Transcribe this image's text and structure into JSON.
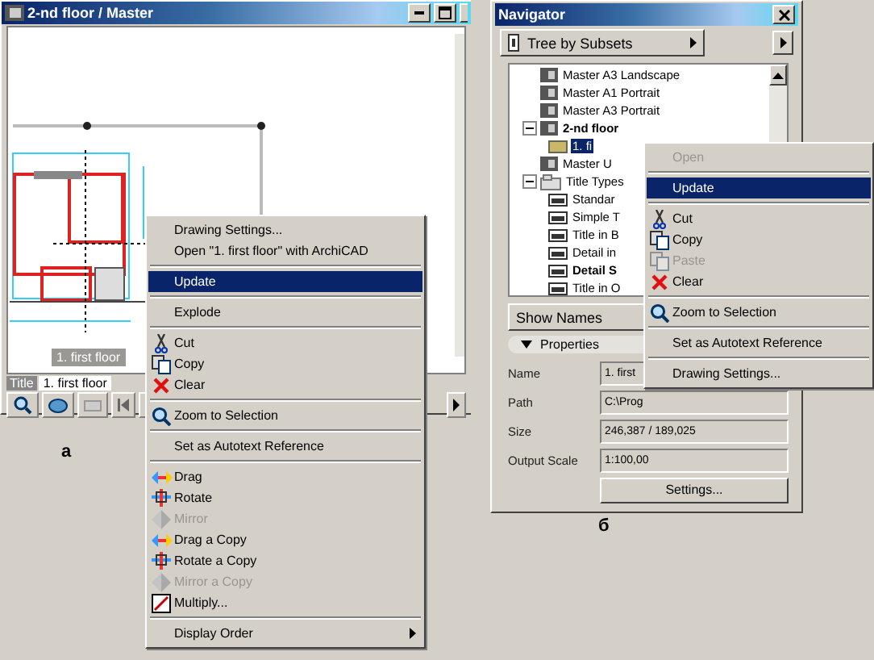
{
  "left_window": {
    "title": "2-nd floor / Master",
    "drawing_label": "1. first floor",
    "title_tab": "Title",
    "title_field": "1. first floor"
  },
  "left_menu": [
    {
      "kind": "plain",
      "label": "Drawing Settings...",
      "selected": false,
      "disabled": false
    },
    {
      "kind": "plain",
      "label": "Open \"1. first floor\" with ArchiCAD",
      "selected": false,
      "disabled": false
    },
    {
      "kind": "separator"
    },
    {
      "kind": "plain",
      "label": "Update",
      "selected": true,
      "disabled": false
    },
    {
      "kind": "separator"
    },
    {
      "kind": "plain",
      "label": "Explode",
      "selected": false,
      "disabled": false
    },
    {
      "kind": "separator"
    },
    {
      "kind": "cut",
      "label": "Cut",
      "selected": false,
      "disabled": false
    },
    {
      "kind": "copy",
      "label": "Copy",
      "selected": false,
      "disabled": false
    },
    {
      "kind": "clear",
      "label": "Clear",
      "selected": false,
      "disabled": false
    },
    {
      "kind": "separator"
    },
    {
      "kind": "zoom",
      "label": "Zoom to Selection",
      "selected": false,
      "disabled": false
    },
    {
      "kind": "separator"
    },
    {
      "kind": "plain",
      "label": "Set as Autotext Reference",
      "selected": false,
      "disabled": false
    },
    {
      "kind": "separator"
    },
    {
      "kind": "drag",
      "label": "Drag",
      "selected": false,
      "disabled": false
    },
    {
      "kind": "rotate",
      "label": "Rotate",
      "selected": false,
      "disabled": false
    },
    {
      "kind": "mirror",
      "label": "Mirror",
      "selected": false,
      "disabled": true
    },
    {
      "kind": "drag",
      "label": "Drag a Copy",
      "selected": false,
      "disabled": false
    },
    {
      "kind": "rotate",
      "label": "Rotate a Copy",
      "selected": false,
      "disabled": false
    },
    {
      "kind": "mirror",
      "label": "Mirror a Copy",
      "selected": false,
      "disabled": true
    },
    {
      "kind": "multiply",
      "label": "Multiply...",
      "selected": false,
      "disabled": false
    },
    {
      "kind": "separator"
    },
    {
      "kind": "submenu",
      "label": "Display Order",
      "selected": false,
      "disabled": false
    }
  ],
  "caption_left": "а",
  "navigator": {
    "title": "Navigator",
    "view_dropdown": "Tree by Subsets",
    "tree": [
      {
        "kind": "layout",
        "label": "Master A3 Landscape",
        "bold": false,
        "selected": false
      },
      {
        "kind": "layout",
        "label": "Master A1 Portrait",
        "bold": false,
        "selected": false
      },
      {
        "kind": "layout",
        "label": "Master A3 Portrait",
        "bold": false,
        "selected": false
      },
      {
        "kind": "layout",
        "label": "2-nd floor",
        "bold": true,
        "selected": false,
        "expanded": true,
        "children": [
          {
            "kind": "drawing",
            "label": "1. fi",
            "bold": false,
            "selected": true
          }
        ]
      },
      {
        "kind": "layout",
        "label": "Master U",
        "bold": false,
        "selected": false
      },
      {
        "kind": "folder",
        "label": "Title Types",
        "bold": false,
        "selected": false,
        "expanded": true,
        "children": [
          {
            "kind": "title",
            "label": "Standar",
            "bold": false,
            "selected": false
          },
          {
            "kind": "title",
            "label": "Simple T",
            "bold": false,
            "selected": false
          },
          {
            "kind": "title",
            "label": "Title in B",
            "bold": false,
            "selected": false
          },
          {
            "kind": "title",
            "label": "Detail in",
            "bold": false,
            "selected": false
          },
          {
            "kind": "title",
            "label": "Detail S",
            "bold": true,
            "selected": false
          },
          {
            "kind": "title",
            "label": "Title in O",
            "bold": false,
            "selected": false
          }
        ]
      }
    ],
    "show_dropdown": "Show Names",
    "properties": {
      "header": "Properties",
      "expanded": true,
      "fields": [
        {
          "label": "Name",
          "value": "1. first"
        },
        {
          "label": "Path",
          "value": "C:\\Prog"
        },
        {
          "label": "Size",
          "value": "246,387 / 189,025"
        },
        {
          "label": "Output Scale",
          "value": "1:100,00"
        }
      ],
      "settings_button": "Settings..."
    }
  },
  "right_menu": [
    {
      "kind": "plain",
      "label": "Open",
      "selected": false,
      "disabled": true
    },
    {
      "kind": "separator"
    },
    {
      "kind": "plain",
      "label": "Update",
      "selected": true,
      "disabled": false
    },
    {
      "kind": "separator"
    },
    {
      "kind": "cut",
      "label": "Cut",
      "selected": false,
      "disabled": false
    },
    {
      "kind": "copy",
      "label": "Copy",
      "selected": false,
      "disabled": false
    },
    {
      "kind": "paste",
      "label": "Paste",
      "selected": false,
      "disabled": true
    },
    {
      "kind": "clear",
      "label": "Clear",
      "selected": false,
      "disabled": false
    },
    {
      "kind": "separator"
    },
    {
      "kind": "zoom",
      "label": "Zoom to Selection",
      "selected": false,
      "disabled": false
    },
    {
      "kind": "separator"
    },
    {
      "kind": "plain",
      "label": "Set as Autotext Reference",
      "selected": false,
      "disabled": false
    },
    {
      "kind": "separator"
    },
    {
      "kind": "plain",
      "label": "Drawing Settings...",
      "selected": false,
      "disabled": false
    }
  ],
  "caption_right": "б"
}
